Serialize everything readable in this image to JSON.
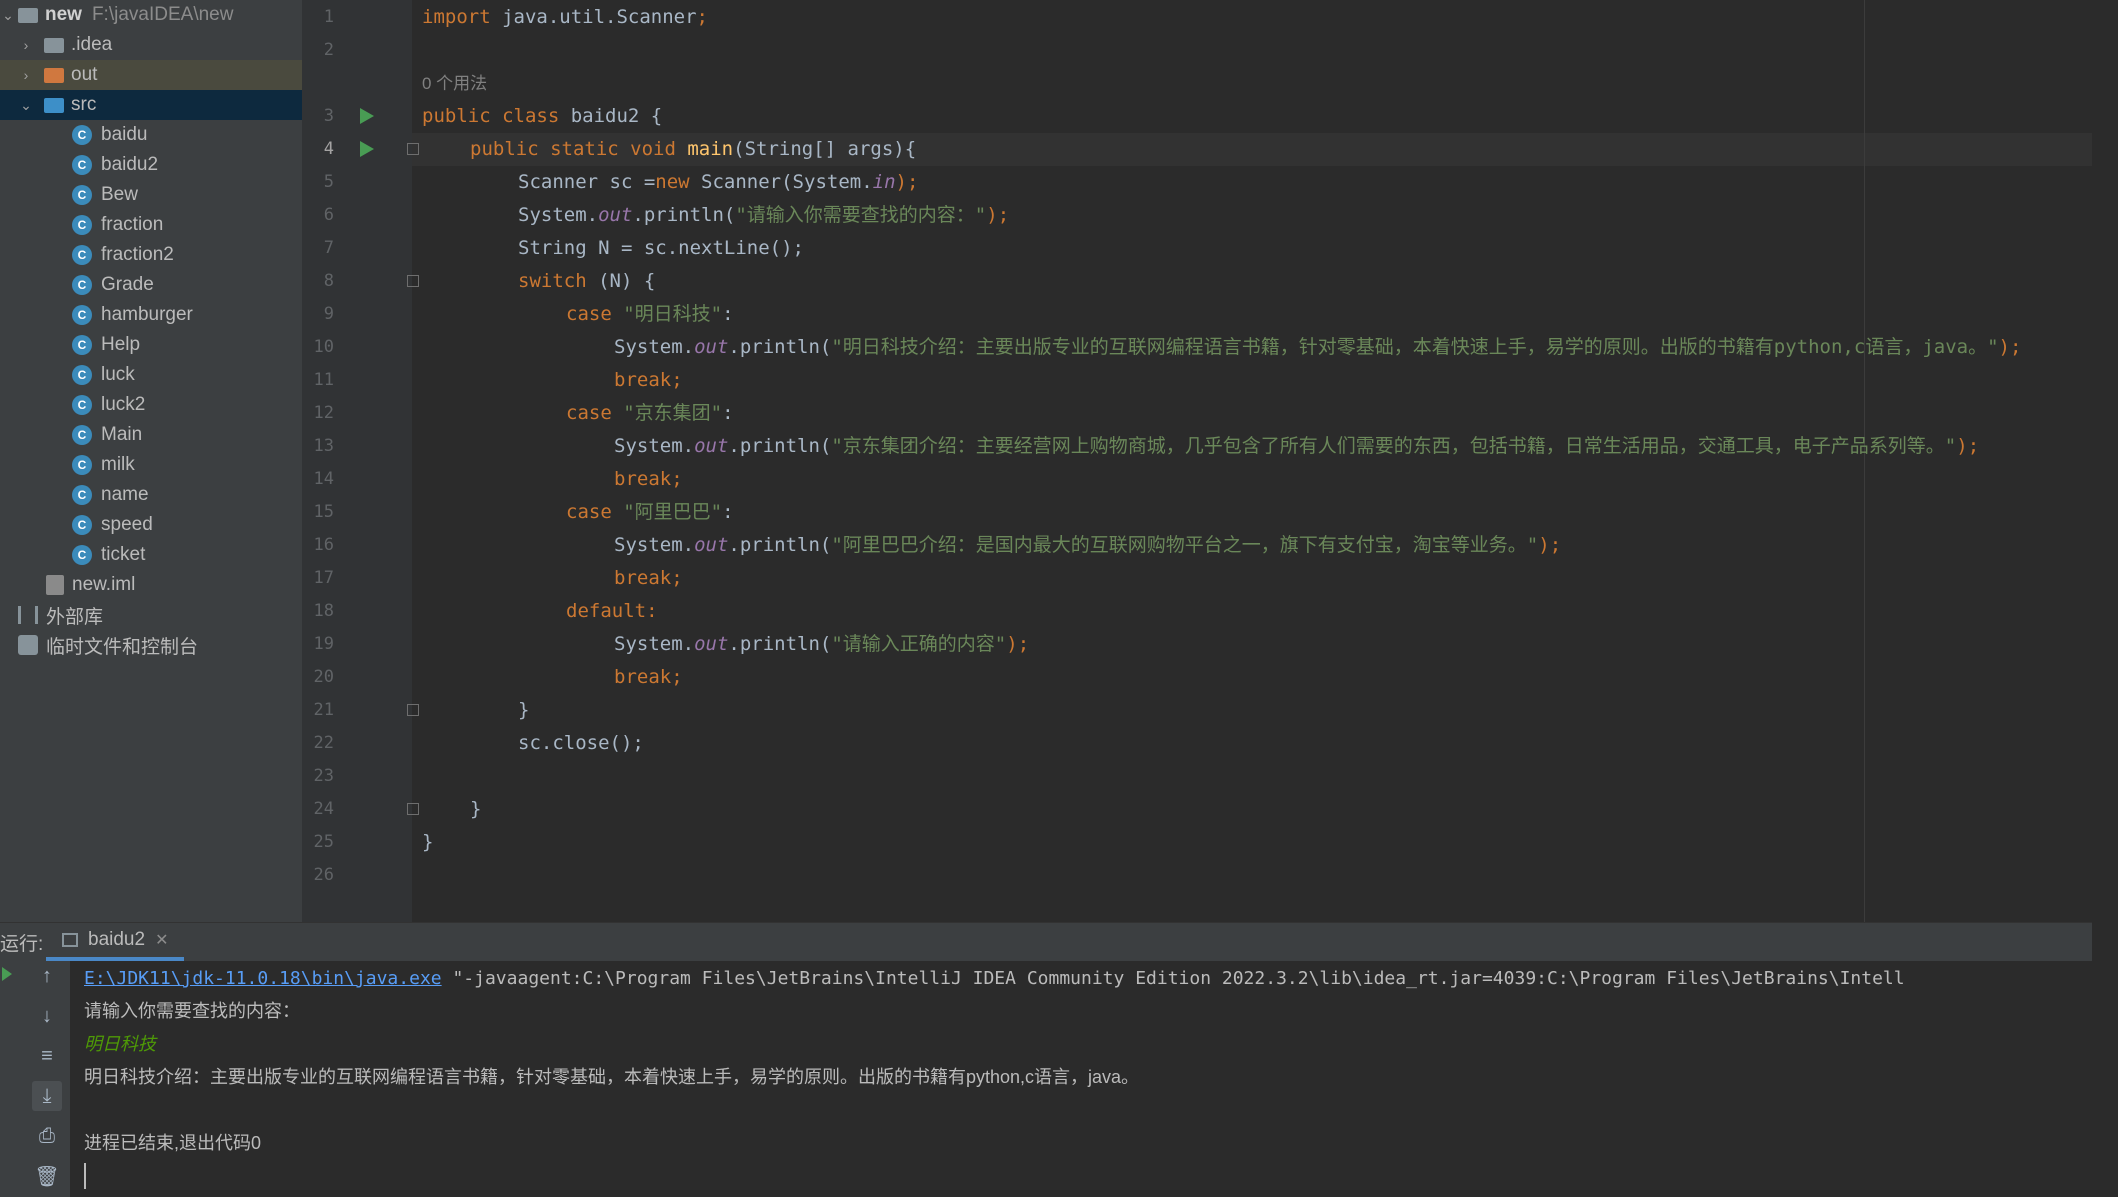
{
  "project": {
    "root_name": "new",
    "root_path": "F:\\javaIDEA\\new",
    "folders": [
      ".idea",
      "out",
      "src"
    ],
    "classes": [
      "baidu",
      "baidu2",
      "Bew",
      "fraction",
      "fraction2",
      "Grade",
      "hamburger",
      "Help",
      "luck",
      "luck2",
      "Main",
      "milk",
      "name",
      "speed",
      "ticket"
    ],
    "file": "new.iml",
    "external_libs": "外部库",
    "scratches": "临时文件和控制台"
  },
  "editor": {
    "usage_hint": "0 个用法",
    "lines": [
      "1",
      "2",
      "3",
      "4",
      "5",
      "6",
      "7",
      "8",
      "9",
      "10",
      "11",
      "12",
      "13",
      "14",
      "15",
      "16",
      "17",
      "18",
      "19",
      "20",
      "21",
      "22",
      "23",
      "24",
      "25",
      "26"
    ],
    "code": {
      "l1_a": "import",
      "l1_b": " java.util.Scanner",
      "l1_c": ";",
      "l3_a": "public class",
      "l3_b": " baidu2 {",
      "l4_a": "public static void",
      "l4_b": "main",
      "l4_c": "(String[] args){",
      "l5_a": "Scanner sc =",
      "l5_b": "new",
      "l5_c": " Scanner(System.",
      "l5_d": "in",
      "l5_e": ");",
      "sys": "System.",
      "out": "out",
      "println": ".println(",
      "l6_s": "\"请输入你需要查找的内容：\"",
      "end": ");",
      "l7": "String N = sc.nextLine();",
      "l8_a": "switch",
      "l8_b": " (N) {",
      "case": "case",
      "colon": ":",
      "l9_s": "\"明日科技\"",
      "l10_s": "\"明日科技介绍：主要出版专业的互联网编程语言书籍，针对零基础，本着快速上手，易学的原则。出版的书籍有python,c语言，java。\"",
      "brk": "break;",
      "l12_s": "\"京东集团\"",
      "l13_s": "\"京东集团介绍：主要经营网上购物商城，几乎包含了所有人们需要的东西，包括书籍，日常生活用品，交通工具，电子产品系列等。\"",
      "l15_s": "\"阿里巴巴\"",
      "l16_s": "\"阿里巴巴介绍：是国内最大的互联网购物平台之一，旗下有支付宝，淘宝等业务。\"",
      "default": "default:",
      "l19_s": "\"请输入正确的内容\"",
      "rbrace": "}",
      "l22": "sc.close();"
    }
  },
  "run_panel": {
    "label": "运行:",
    "tab": "baidu2",
    "cmd_link": "E:\\JDK11\\jdk-11.0.18\\bin\\java.exe",
    "cmd_rest": " \"-javaagent:C:\\Program Files\\JetBrains\\IntelliJ IDEA Community Edition 2022.3.2\\lib\\idea_rt.jar=4039:C:\\Program Files\\JetBrains\\Intell",
    "prompt": "请输入你需要查找的内容：",
    "input": "明日科技",
    "output": "明日科技介绍：主要出版专业的互联网编程语言书籍，针对零基础，本着快速上手，易学的原则。出版的书籍有python,c语言，java。",
    "exit": "进程已结束,退出代码0"
  },
  "colors": {
    "keyword": "#cc7832",
    "string": "#6a8759",
    "field": "#9876aa",
    "function": "#ffc66d",
    "link": "#589df6"
  }
}
